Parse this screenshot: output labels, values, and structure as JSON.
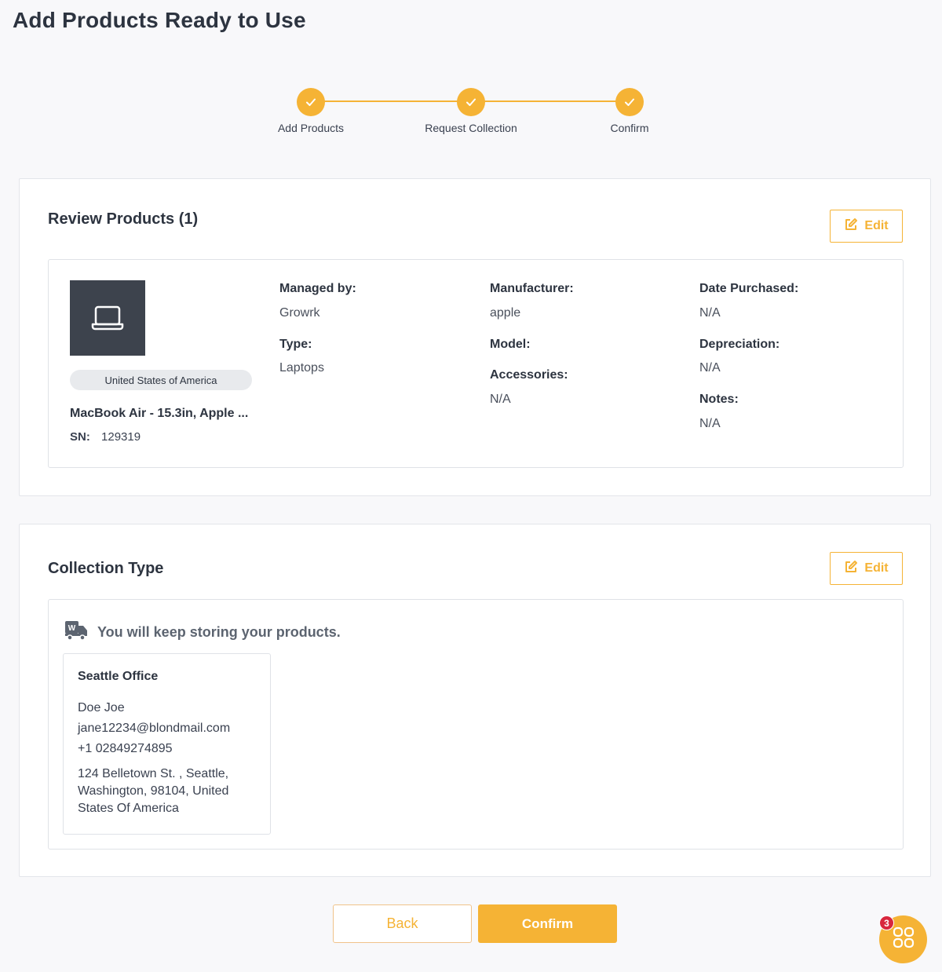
{
  "page": {
    "title": "Add Products Ready to Use"
  },
  "stepper": {
    "steps": [
      {
        "label": "Add Products",
        "status": "complete"
      },
      {
        "label": "Request Collection",
        "status": "complete"
      },
      {
        "label": "Confirm",
        "status": "complete"
      }
    ],
    "accent_color": "#f5b335"
  },
  "review": {
    "title": "Review Products (1)",
    "edit_label": "Edit",
    "product": {
      "icon": "laptop-icon",
      "country": "United States of America",
      "name": "MacBook Air - 15.3in, Apple ...",
      "sn_label": "SN:",
      "sn_value": "129319",
      "managed_by_label": "Managed by:",
      "managed_by_value": "Growrk",
      "type_label": "Type:",
      "type_value": "Laptops",
      "manufacturer_label": "Manufacturer:",
      "manufacturer_value": "apple",
      "model_label": "Model:",
      "accessories_label": "Accessories:",
      "accessories_value": "N/A",
      "date_purchased_label": "Date Purchased:",
      "date_purchased_value": "N/A",
      "depreciation_label": "Depreciation:",
      "depreciation_value": "N/A",
      "notes_label": "Notes:",
      "notes_value": "N/A"
    }
  },
  "collection": {
    "title": "Collection Type",
    "edit_label": "Edit",
    "message_icon": "warehouse-truck-icon",
    "message": "You will keep storing your products.",
    "address": {
      "name": "Seattle Office",
      "contact": "Doe Joe",
      "email": "jane12234@blondmail.com",
      "phone": "+1 02849274895",
      "address": "124 Belletown St. , Seattle, Washington, 98104, United States Of America"
    }
  },
  "actions": {
    "back_label": "Back",
    "confirm_label": "Confirm"
  },
  "fab": {
    "badge_count": "3",
    "icon": "apps-grid-icon"
  }
}
